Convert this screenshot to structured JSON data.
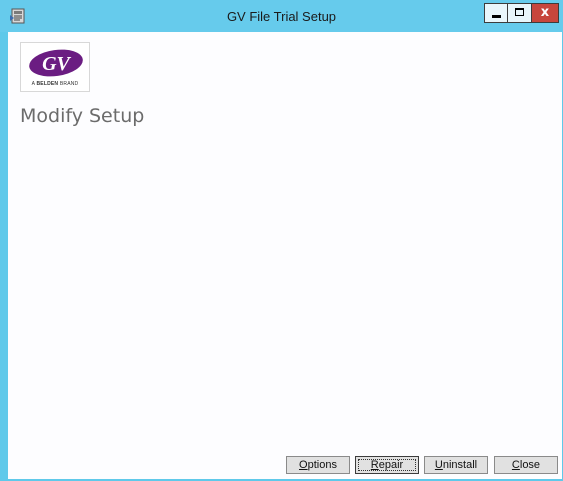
{
  "window": {
    "title": "GV File Trial Setup",
    "controls": {
      "minimize_icon": "minimize-icon",
      "maximize_icon": "maximize-icon",
      "close_label": "x"
    }
  },
  "logo": {
    "mark": "GV",
    "brand_prefix": "A",
    "brand_bold": "BELDEN",
    "brand_suffix": "BRAND",
    "colors": {
      "oval": "#6b1d82",
      "letters": "#ffffff"
    }
  },
  "page": {
    "title": "Modify Setup"
  },
  "buttons": {
    "options": {
      "underline": "O",
      "rest": "ptions"
    },
    "repair": {
      "underline": "R",
      "rest": "epair"
    },
    "uninstall": {
      "underline": "U",
      "rest": "ninstall"
    },
    "close": {
      "underline": "C",
      "rest": "lose"
    }
  },
  "colors": {
    "titlebar": "#66cbec",
    "close_button": "#c7463c",
    "client_background": "#fdfdff"
  }
}
